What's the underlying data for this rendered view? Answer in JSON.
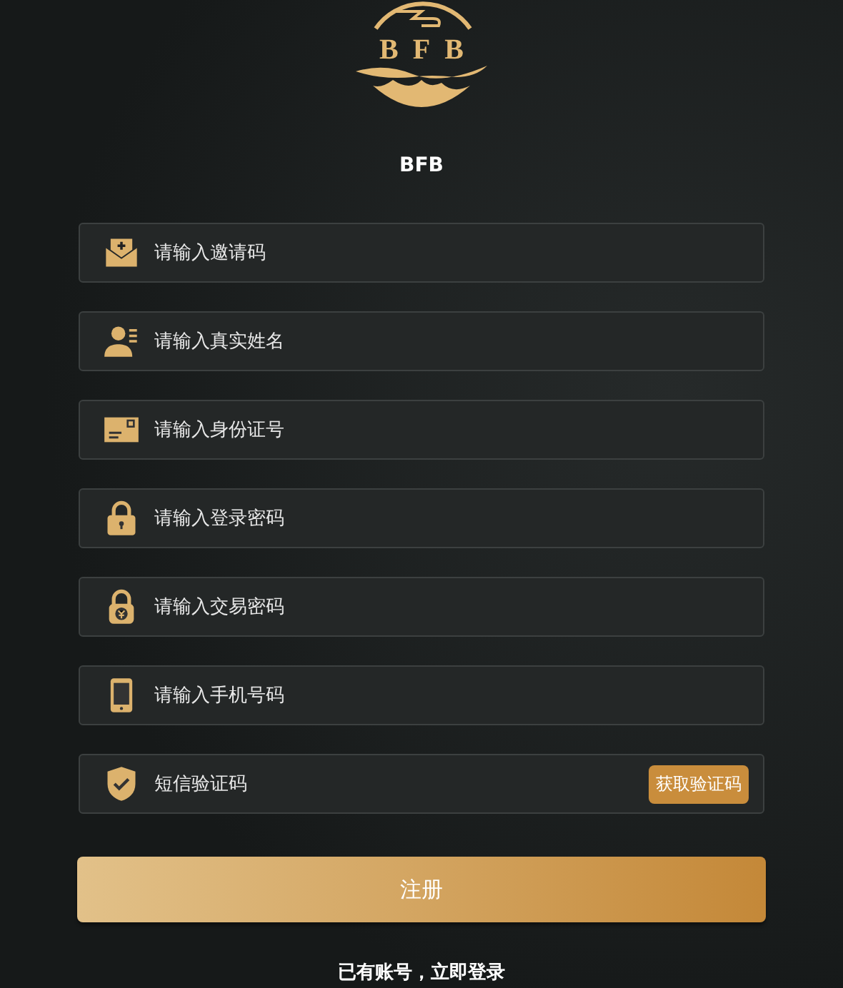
{
  "logo": {
    "text": "BFB"
  },
  "app_name": "BFB",
  "fields": [
    {
      "kind": "invite",
      "placeholder": "请输入邀请码"
    },
    {
      "kind": "name",
      "placeholder": "请输入真实姓名"
    },
    {
      "kind": "idcard",
      "placeholder": "请输入身份证号"
    },
    {
      "kind": "password",
      "placeholder": "请输入登录密码"
    },
    {
      "kind": "trade",
      "placeholder": "请输入交易密码"
    },
    {
      "kind": "phone",
      "placeholder": "请输入手机号码"
    },
    {
      "kind": "sms",
      "placeholder": "短信验证码",
      "action": "获取验证码"
    }
  ],
  "submit": "注册",
  "login_link": "已有账号，立即登录"
}
